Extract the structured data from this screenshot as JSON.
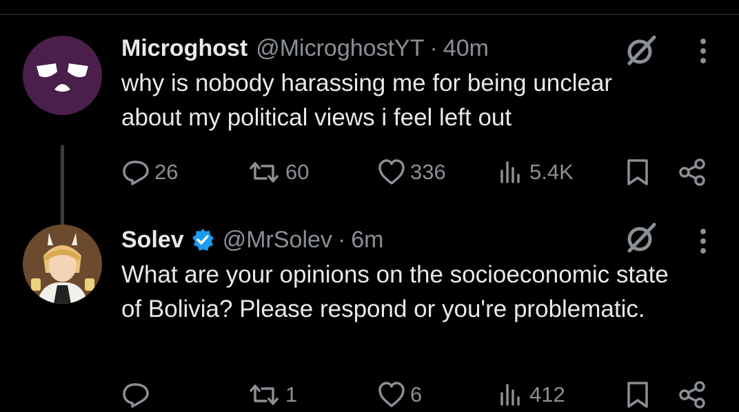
{
  "tweets": [
    {
      "name": "Microghost",
      "handle": "@MicroghostYT",
      "separator": "·",
      "time": "40m",
      "text": "why is nobody harassing me for being unclear about my political views i feel left out",
      "stats": {
        "replies": "26",
        "reposts": "60",
        "likes": "336",
        "views": "5.4K"
      }
    },
    {
      "name": "Solev",
      "verified": true,
      "handle": "@MrSolev",
      "separator": "·",
      "time": "6m",
      "text": "What are your opinions on the socioeconomic state of Bolivia? Please respond or you're problematic.",
      "stats": {
        "replies": "",
        "reposts": "1",
        "likes": "6",
        "views": "412"
      }
    }
  ],
  "icons": {
    "reply": "reply-icon",
    "repost": "repost-icon",
    "like": "like-icon",
    "views": "views-icon",
    "bookmark": "bookmark-icon",
    "share": "share-icon",
    "grok": "grok-icon",
    "more": "more-icon",
    "verified": "verified-badge-icon"
  },
  "colors": {
    "background": "#000000",
    "text": "#e7e9ea",
    "secondary": "#8b9096",
    "verified": "#1d9bf0"
  }
}
